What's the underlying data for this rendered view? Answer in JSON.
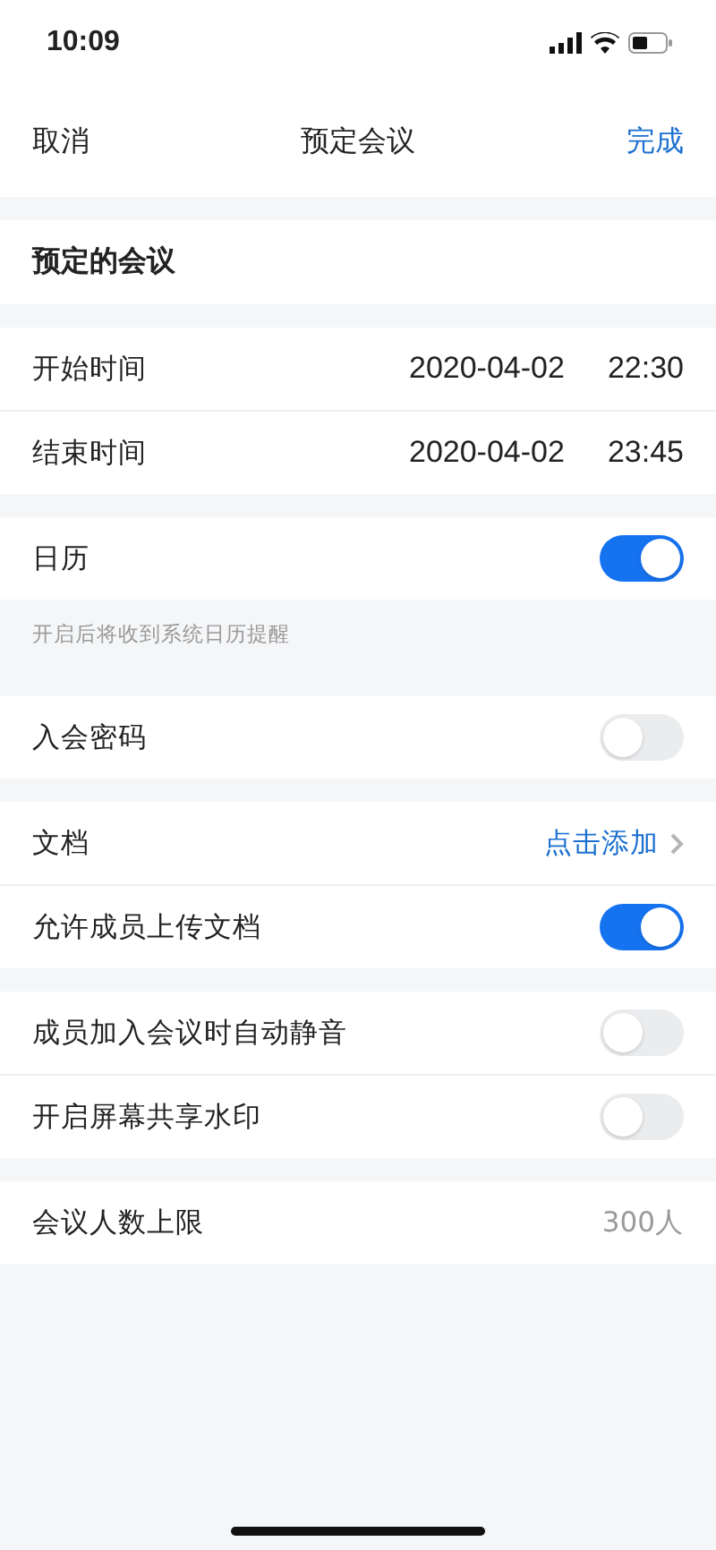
{
  "status_bar": {
    "time": "10:09"
  },
  "nav": {
    "cancel": "取消",
    "title": "预定会议",
    "done": "完成"
  },
  "header": "预定的会议",
  "sections": [
    {
      "rows": [
        {
          "kind": "datetime",
          "label": "开始时间",
          "date": "2020-04-02",
          "time": "22:30"
        },
        {
          "kind": "datetime",
          "label": "结束时间",
          "date": "2020-04-02",
          "time": "23:45"
        }
      ]
    },
    {
      "rows": [
        {
          "kind": "toggle",
          "label": "日历",
          "on": true
        }
      ],
      "footer": "开启后将收到系统日历提醒"
    },
    {
      "rows": [
        {
          "kind": "toggle",
          "label": "入会密码",
          "on": false
        }
      ]
    },
    {
      "rows": [
        {
          "kind": "link",
          "label": "文档",
          "value": "点击添加"
        },
        {
          "kind": "toggle",
          "label": "允许成员上传文档",
          "on": true
        }
      ]
    },
    {
      "rows": [
        {
          "kind": "toggle",
          "label": "成员加入会议时自动静音",
          "on": false
        },
        {
          "kind": "toggle",
          "label": "开启屏幕共享水印",
          "on": false
        }
      ]
    },
    {
      "rows": [
        {
          "kind": "value",
          "label": "会议人数上限",
          "value": "300人"
        }
      ]
    }
  ]
}
